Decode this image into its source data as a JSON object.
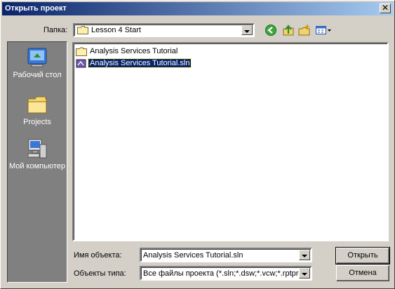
{
  "window": {
    "title": "Открыть проект",
    "close": "✕"
  },
  "lookin": {
    "label": "Папка:",
    "value": "Lesson 4 Start"
  },
  "toolbar": {
    "back_icon": "back-arrow-icon",
    "up_icon": "up-folder-icon",
    "new_folder_icon": "new-folder-icon",
    "views_icon": "views-menu-icon"
  },
  "places": [
    {
      "label": "Рабочий стол",
      "icon": "desktop-icon"
    },
    {
      "label": "Projects",
      "icon": "folder-icon"
    },
    {
      "label": "Мой компьютер",
      "icon": "my-computer-icon"
    }
  ],
  "files": [
    {
      "name": "Analysis Services Tutorial",
      "type": "folder",
      "selected": false
    },
    {
      "name": "Analysis Services Tutorial.sln",
      "type": "solution",
      "selected": true
    }
  ],
  "filename": {
    "label": "Имя объекта:",
    "value": "Analysis Services Tutorial.sln"
  },
  "filetype": {
    "label": "Объекты типа:",
    "value": "Все файлы проекта (*.sln;*.dsw;*.vcw;*.rptproj"
  },
  "buttons": {
    "open": "Открыть",
    "cancel": "Отмена"
  }
}
